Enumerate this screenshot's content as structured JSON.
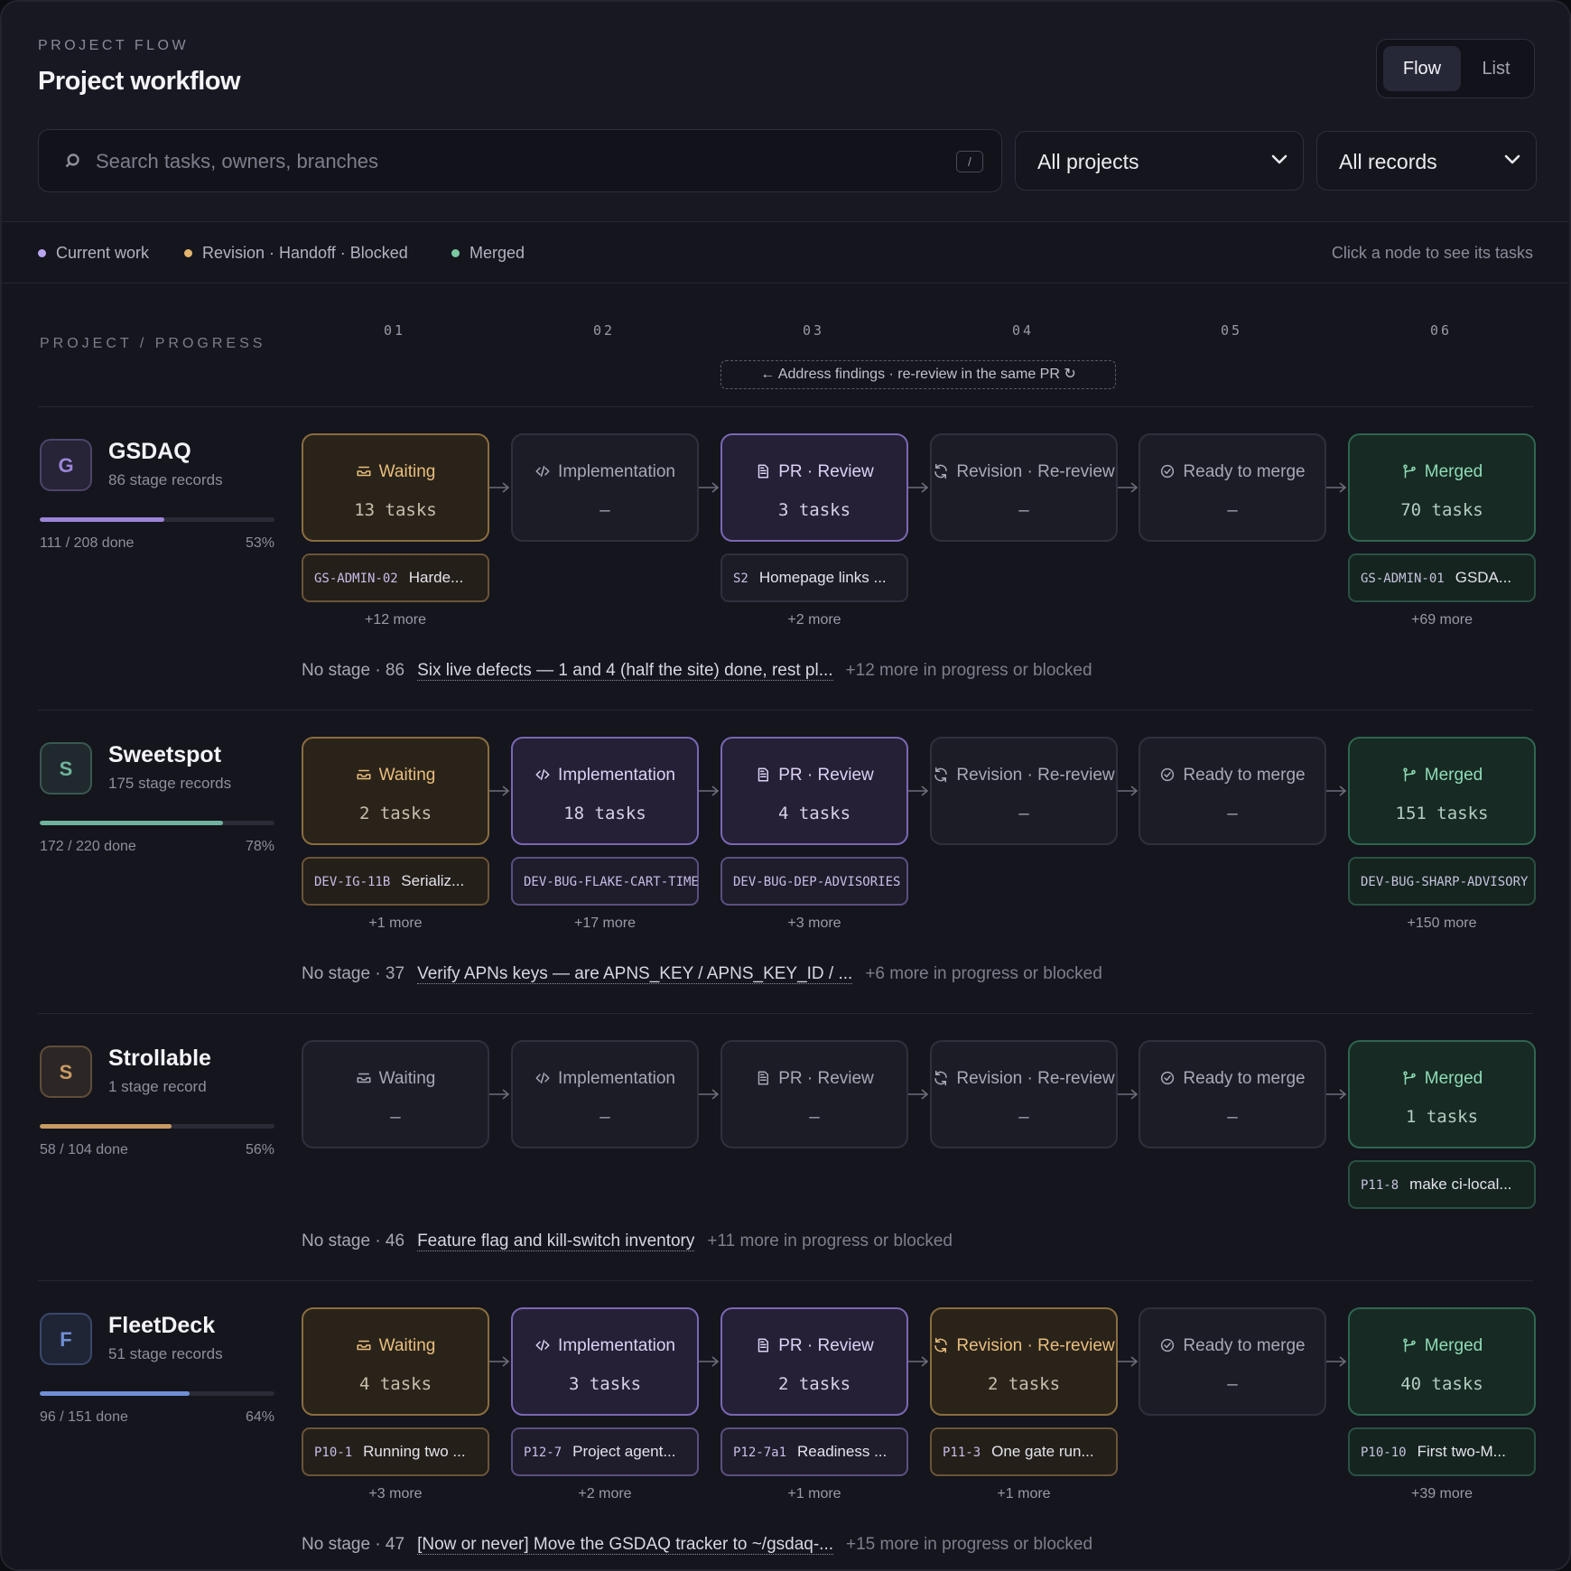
{
  "header": {
    "eyebrow": "PROJECT FLOW",
    "title": "Project workflow",
    "view_toggle": {
      "flow": "Flow",
      "list": "List"
    }
  },
  "search": {
    "placeholder": "Search tasks, owners, branches",
    "shortcut": "/"
  },
  "filters": {
    "projects": "All projects",
    "records": "All records"
  },
  "legend": {
    "current": "Current work",
    "revision": "Revision · Handoff · Blocked",
    "merged": "Merged",
    "hint": "Click a node to see its tasks",
    "colors": {
      "current": "#b9a4ee",
      "revision": "#e3b56f",
      "merged": "#7ccaa2"
    }
  },
  "board": {
    "col_header": "PROJECT / PROGRESS",
    "columns": [
      "01",
      "02",
      "03",
      "04",
      "05",
      "06"
    ],
    "loopback": "← Address findings · re-review in the same PR ↻"
  },
  "stage_labels": [
    "Waiting",
    "Implementation",
    "PR · Review",
    "Revision · Re-review",
    "Ready to merge",
    "Merged"
  ],
  "stage_icons": [
    "inbox-icon",
    "code-icon",
    "document-icon",
    "refresh-icon",
    "check-circle-icon",
    "git-merge-icon"
  ],
  "projects": [
    {
      "initial": "G",
      "name": "GSDAQ",
      "records": "86 stage records",
      "done": "111 / 208 done",
      "pct": "53%",
      "progress": 0.53,
      "color": "#9c85d8",
      "nodes": [
        {
          "state": "wait",
          "count": "13 tasks"
        },
        {
          "state": "empty",
          "count": "—"
        },
        {
          "state": "cur",
          "count": "3 tasks"
        },
        {
          "state": "empty",
          "count": "—"
        },
        {
          "state": "empty",
          "count": "—"
        },
        {
          "state": "mer",
          "count": "70 tasks"
        }
      ],
      "chips": [
        {
          "col": 0,
          "state": "wait",
          "id": "GS-ADMIN-02",
          "text": "Harde...",
          "more": "+12 more"
        },
        {
          "col": 2,
          "state": "empty",
          "id": "S2",
          "text": "Homepage links ...",
          "more": "+2 more"
        },
        {
          "col": 5,
          "state": "mer",
          "id": "GS-ADMIN-01",
          "text": "GSDA...",
          "more": "+69 more"
        }
      ],
      "nostage": {
        "label": "No stage · 86",
        "link": "Six live defects — 1 and 4 (half the site) done, rest pl...",
        "rest": "+12 more in progress or blocked"
      }
    },
    {
      "initial": "S",
      "name": "Sweetspot",
      "records": "175 stage records",
      "done": "172 / 220 done",
      "pct": "78%",
      "progress": 0.78,
      "color": "#6fb39c",
      "nodes": [
        {
          "state": "wait",
          "count": "2 tasks"
        },
        {
          "state": "cur",
          "count": "18 tasks"
        },
        {
          "state": "cur",
          "count": "4 tasks"
        },
        {
          "state": "empty",
          "count": "—"
        },
        {
          "state": "empty",
          "count": "—"
        },
        {
          "state": "mer",
          "count": "151 tasks"
        }
      ],
      "chips": [
        {
          "col": 0,
          "state": "wait",
          "id": "DEV-IG-11B",
          "text": "Serializ...",
          "more": "+1 more"
        },
        {
          "col": 1,
          "state": "cur",
          "id": "DEV-BUG-FLAKE-CART-TIME",
          "text": "",
          "more": "+17 more"
        },
        {
          "col": 2,
          "state": "cur",
          "id": "DEV-BUG-DEP-ADVISORIES",
          "text": "",
          "more": "+3 more"
        },
        {
          "col": 5,
          "state": "mer",
          "id": "DEV-BUG-SHARP-ADVISORY",
          "text": "",
          "more": "+150 more"
        }
      ],
      "nostage": {
        "label": "No stage · 37",
        "link": "Verify APNs keys — are APNS_KEY / APNS_KEY_ID / ...",
        "rest": "+6 more in progress or blocked"
      }
    },
    {
      "initial": "S",
      "name": "Strollable",
      "records": "1 stage record",
      "done": "58 / 104 done",
      "pct": "56%",
      "progress": 0.56,
      "color": "#c99a63",
      "nodes": [
        {
          "state": "empty",
          "count": "—"
        },
        {
          "state": "empty",
          "count": "—"
        },
        {
          "state": "empty",
          "count": "—"
        },
        {
          "state": "empty",
          "count": "—"
        },
        {
          "state": "empty",
          "count": "—"
        },
        {
          "state": "mer",
          "count": "1 tasks"
        }
      ],
      "chips": [
        {
          "col": 5,
          "state": "mer",
          "id": "P11-8",
          "text": "make ci-local...",
          "more": ""
        }
      ],
      "nostage": {
        "label": "No stage · 46",
        "link": "Feature flag and kill-switch inventory",
        "rest": "+11 more in progress or blocked"
      }
    },
    {
      "initial": "F",
      "name": "FleetDeck",
      "records": "51 stage records",
      "done": "96 / 151 done",
      "pct": "64%",
      "progress": 0.64,
      "color": "#6f8fd6",
      "nodes": [
        {
          "state": "wait",
          "count": "4 tasks"
        },
        {
          "state": "cur",
          "count": "3 tasks"
        },
        {
          "state": "cur",
          "count": "2 tasks"
        },
        {
          "state": "rev",
          "count": "2 tasks"
        },
        {
          "state": "empty",
          "count": "—"
        },
        {
          "state": "mer",
          "count": "40 tasks"
        }
      ],
      "chips": [
        {
          "col": 0,
          "state": "wait",
          "id": "P10-1",
          "text": "Running two ...",
          "more": "+3 more"
        },
        {
          "col": 1,
          "state": "cur",
          "id": "P12-7",
          "text": "Project agent...",
          "more": "+2 more"
        },
        {
          "col": 2,
          "state": "cur",
          "id": "P12-7a1",
          "text": "Readiness ...",
          "more": "+1 more"
        },
        {
          "col": 3,
          "state": "rev",
          "id": "P11-3",
          "text": "One gate run...",
          "more": "+1 more"
        },
        {
          "col": 5,
          "state": "mer",
          "id": "P10-10",
          "text": "First two-M...",
          "more": "+39 more"
        }
      ],
      "nostage": {
        "label": "No stage · 47",
        "link": "[Now or never] Move the GSDAQ tracker to ~/gsdaq-...",
        "rest": "+15 more in progress or blocked"
      }
    }
  ]
}
